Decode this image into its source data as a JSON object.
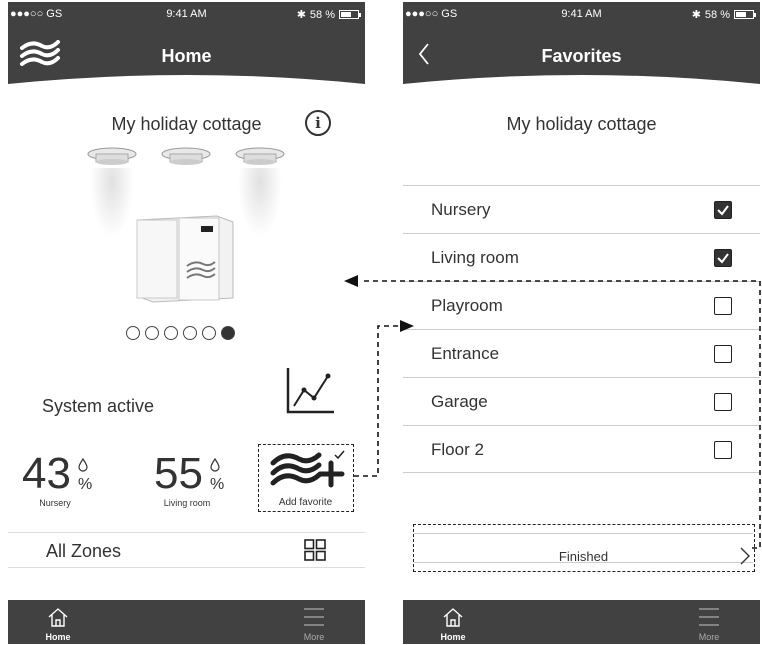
{
  "status_bar": {
    "carrier": "●●●○○ GS",
    "time": "9:41 AM",
    "battery": "58 %"
  },
  "home_screen": {
    "title": "Home",
    "cottage_name": "My holiday cottage",
    "info_icon_glyph": "i",
    "page_dots": {
      "count": 6,
      "active_index": 5
    },
    "system_status": "System active",
    "stats": [
      {
        "value": "43",
        "unit": "%",
        "zone": "Nursery"
      },
      {
        "value": "55",
        "unit": "%",
        "zone": "Living room"
      }
    ],
    "add_favorite_label": "Add favorite",
    "all_zones_label": "All Zones"
  },
  "favorites_screen": {
    "title": "Favorites",
    "cottage_name": "My holiday cottage",
    "rooms": [
      {
        "label": "Nursery",
        "checked": true
      },
      {
        "label": "Living room",
        "checked": true
      },
      {
        "label": "Playroom",
        "checked": false
      },
      {
        "label": "Entrance",
        "checked": false
      },
      {
        "label": "Garage",
        "checked": false
      },
      {
        "label": "Floor 2",
        "checked": false
      }
    ],
    "finished_label": "Finished"
  },
  "tabbar": {
    "home_label": "Home",
    "more_label": "More"
  },
  "icons": {
    "logo": "wave-logo-icon",
    "info": "info-icon",
    "graph": "line-graph-icon",
    "add_favorite": "wave-plus-icon",
    "grid": "grid-icon",
    "home": "house-icon",
    "more": "hamburger-icon",
    "back": "chevron-left-icon",
    "forward": "chevron-right-icon"
  },
  "colors": {
    "header": "#414141",
    "text": "#333333",
    "accent_white": "#ffffff"
  }
}
